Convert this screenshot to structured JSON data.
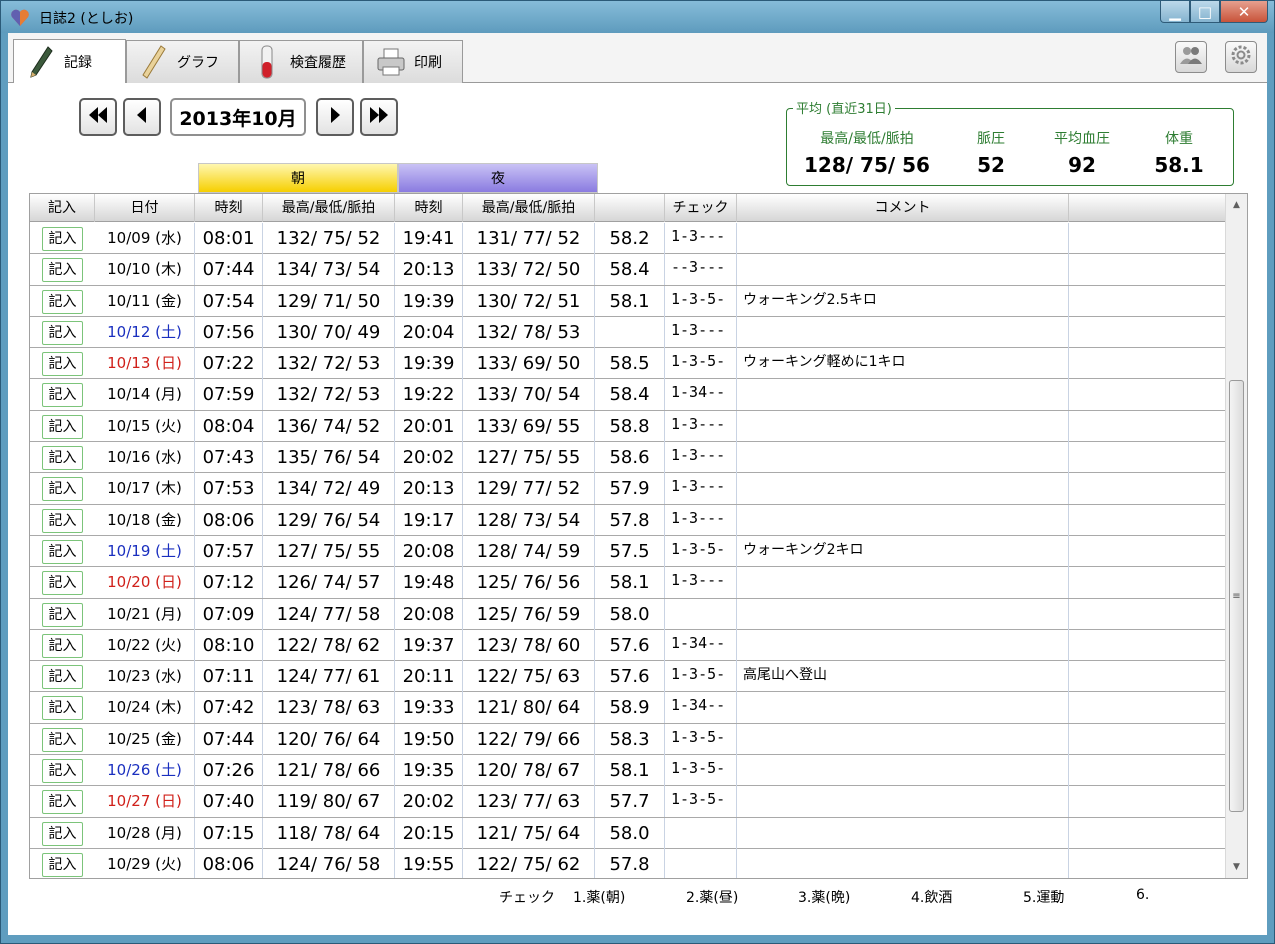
{
  "window": {
    "title": "日誌2 (としお)"
  },
  "tabs": [
    {
      "label": "記録",
      "icon": "pen-icon"
    },
    {
      "label": "グラフ",
      "icon": "ruler-icon"
    },
    {
      "label": "検査履歴",
      "icon": "test-tube-icon"
    },
    {
      "label": "印刷",
      "icon": "printer-icon"
    }
  ],
  "toolbar": {
    "users_icon": "users-icon",
    "settings_icon": "gear-icon"
  },
  "navigation": {
    "month": "2013年10月"
  },
  "average": {
    "title": "平均 (直近31日)",
    "bp_label": "最高/最低/脈拍",
    "pp_label": "脈圧",
    "map_label": "平均血圧",
    "weight_label": "体重",
    "bp_value": "128/ 75/ 56",
    "pp_value": "52",
    "map_value": "92",
    "weight_value": "58.1"
  },
  "bands": {
    "morning": "朝",
    "night": "夜"
  },
  "columns": {
    "record": "記入",
    "date": "日付",
    "time_am": "時刻",
    "bp_am": "最高/最低/脈拍",
    "time_pm": "時刻",
    "bp_pm": "最高/最低/脈拍",
    "weight": "",
    "check": "チェック",
    "comment": "コメント",
    "extra": ""
  },
  "record_button_label": "記入",
  "rows": [
    {
      "date": "10/09 (水)",
      "day": "weekday",
      "time_am": "08:01",
      "bp_am": "132/ 75/ 52",
      "time_pm": "19:41",
      "bp_pm": "131/ 77/ 52",
      "weight": "58.2",
      "check": "1-3---",
      "comment": ""
    },
    {
      "date": "10/10 (木)",
      "day": "weekday",
      "time_am": "07:44",
      "bp_am": "134/ 73/ 54",
      "time_pm": "20:13",
      "bp_pm": "133/ 72/ 50",
      "weight": "58.4",
      "check": "--3---",
      "comment": ""
    },
    {
      "date": "10/11 (金)",
      "day": "weekday",
      "time_am": "07:54",
      "bp_am": "129/ 71/ 50",
      "time_pm": "19:39",
      "bp_pm": "130/ 72/ 51",
      "weight": "58.1",
      "check": "1-3-5-",
      "comment": "ウォーキング2.5キロ"
    },
    {
      "date": "10/12 (土)",
      "day": "sat",
      "time_am": "07:56",
      "bp_am": "130/ 70/ 49",
      "time_pm": "20:04",
      "bp_pm": "132/ 78/ 53",
      "weight": "",
      "check": "1-3---",
      "comment": ""
    },
    {
      "date": "10/13 (日)",
      "day": "sun",
      "time_am": "07:22",
      "bp_am": "132/ 72/ 53",
      "time_pm": "19:39",
      "bp_pm": "133/ 69/ 50",
      "weight": "58.5",
      "check": "1-3-5-",
      "comment": "ウォーキング軽めに1キロ"
    },
    {
      "date": "10/14 (月)",
      "day": "weekday",
      "time_am": "07:59",
      "bp_am": "132/ 72/ 53",
      "time_pm": "19:22",
      "bp_pm": "133/ 70/ 54",
      "weight": "58.4",
      "check": "1-34--",
      "comment": ""
    },
    {
      "date": "10/15 (火)",
      "day": "weekday",
      "time_am": "08:04",
      "bp_am": "136/ 74/ 52",
      "time_pm": "20:01",
      "bp_pm": "133/ 69/ 55",
      "weight": "58.8",
      "check": "1-3---",
      "comment": ""
    },
    {
      "date": "10/16 (水)",
      "day": "weekday",
      "time_am": "07:43",
      "bp_am": "135/ 76/ 54",
      "time_pm": "20:02",
      "bp_pm": "127/ 75/ 55",
      "weight": "58.6",
      "check": "1-3---",
      "comment": ""
    },
    {
      "date": "10/17 (木)",
      "day": "weekday",
      "time_am": "07:53",
      "bp_am": "134/ 72/ 49",
      "time_pm": "20:13",
      "bp_pm": "129/ 77/ 52",
      "weight": "57.9",
      "check": "1-3---",
      "comment": ""
    },
    {
      "date": "10/18 (金)",
      "day": "weekday",
      "time_am": "08:06",
      "bp_am": "129/ 76/ 54",
      "time_pm": "19:17",
      "bp_pm": "128/ 73/ 54",
      "weight": "57.8",
      "check": "1-3---",
      "comment": ""
    },
    {
      "date": "10/19 (土)",
      "day": "sat",
      "time_am": "07:57",
      "bp_am": "127/ 75/ 55",
      "time_pm": "20:08",
      "bp_pm": "128/ 74/ 59",
      "weight": "57.5",
      "check": "1-3-5-",
      "comment": "ウォーキング2キロ"
    },
    {
      "date": "10/20 (日)",
      "day": "sun",
      "time_am": "07:12",
      "bp_am": "126/ 74/ 57",
      "time_pm": "19:48",
      "bp_pm": "125/ 76/ 56",
      "weight": "58.1",
      "check": "1-3---",
      "comment": ""
    },
    {
      "date": "10/21 (月)",
      "day": "weekday",
      "time_am": "07:09",
      "bp_am": "124/ 77/ 58",
      "time_pm": "20:08",
      "bp_pm": "125/ 76/ 59",
      "weight": "58.0",
      "check": "",
      "comment": ""
    },
    {
      "date": "10/22 (火)",
      "day": "weekday",
      "time_am": "08:10",
      "bp_am": "122/ 78/ 62",
      "time_pm": "19:37",
      "bp_pm": "123/ 78/ 60",
      "weight": "57.6",
      "check": "1-34--",
      "comment": ""
    },
    {
      "date": "10/23 (水)",
      "day": "weekday",
      "time_am": "07:11",
      "bp_am": "124/ 77/ 61",
      "time_pm": "20:11",
      "bp_pm": "122/ 75/ 63",
      "weight": "57.6",
      "check": "1-3-5-",
      "comment": "高尾山へ登山"
    },
    {
      "date": "10/24 (木)",
      "day": "weekday",
      "time_am": "07:42",
      "bp_am": "123/ 78/ 63",
      "time_pm": "19:33",
      "bp_pm": "121/ 80/ 64",
      "weight": "58.9",
      "check": "1-34--",
      "comment": ""
    },
    {
      "date": "10/25 (金)",
      "day": "weekday",
      "time_am": "07:44",
      "bp_am": "120/ 76/ 64",
      "time_pm": "19:50",
      "bp_pm": "122/ 79/ 66",
      "weight": "58.3",
      "check": "1-3-5-",
      "comment": ""
    },
    {
      "date": "10/26 (土)",
      "day": "sat",
      "time_am": "07:26",
      "bp_am": "121/ 78/ 66",
      "time_pm": "19:35",
      "bp_pm": "120/ 78/ 67",
      "weight": "58.1",
      "check": "1-3-5-",
      "comment": ""
    },
    {
      "date": "10/27 (日)",
      "day": "sun",
      "time_am": "07:40",
      "bp_am": "119/ 80/ 67",
      "time_pm": "20:02",
      "bp_pm": "123/ 77/ 63",
      "weight": "57.7",
      "check": "1-3-5-",
      "comment": ""
    },
    {
      "date": "10/28 (月)",
      "day": "weekday",
      "time_am": "07:15",
      "bp_am": "118/ 78/ 64",
      "time_pm": "20:15",
      "bp_pm": "121/ 75/ 64",
      "weight": "58.0",
      "check": "",
      "comment": ""
    },
    {
      "date": "10/29 (火)",
      "day": "weekday",
      "time_am": "08:06",
      "bp_am": "124/ 76/ 58",
      "time_pm": "19:55",
      "bp_pm": "122/ 75/ 62",
      "weight": "57.8",
      "check": "",
      "comment": ""
    }
  ],
  "legend": {
    "label": "チェック",
    "items": [
      "1.薬(朝)",
      "2.薬(昼)",
      "3.薬(晩)",
      "4.飲酒",
      "5.運動",
      "6."
    ]
  },
  "colors": {
    "saturday": "#1a2fbf",
    "sunday": "#d0201a",
    "average_green": "#2e7d32",
    "morning": "#f6cf00",
    "night": "#8a7be0"
  }
}
